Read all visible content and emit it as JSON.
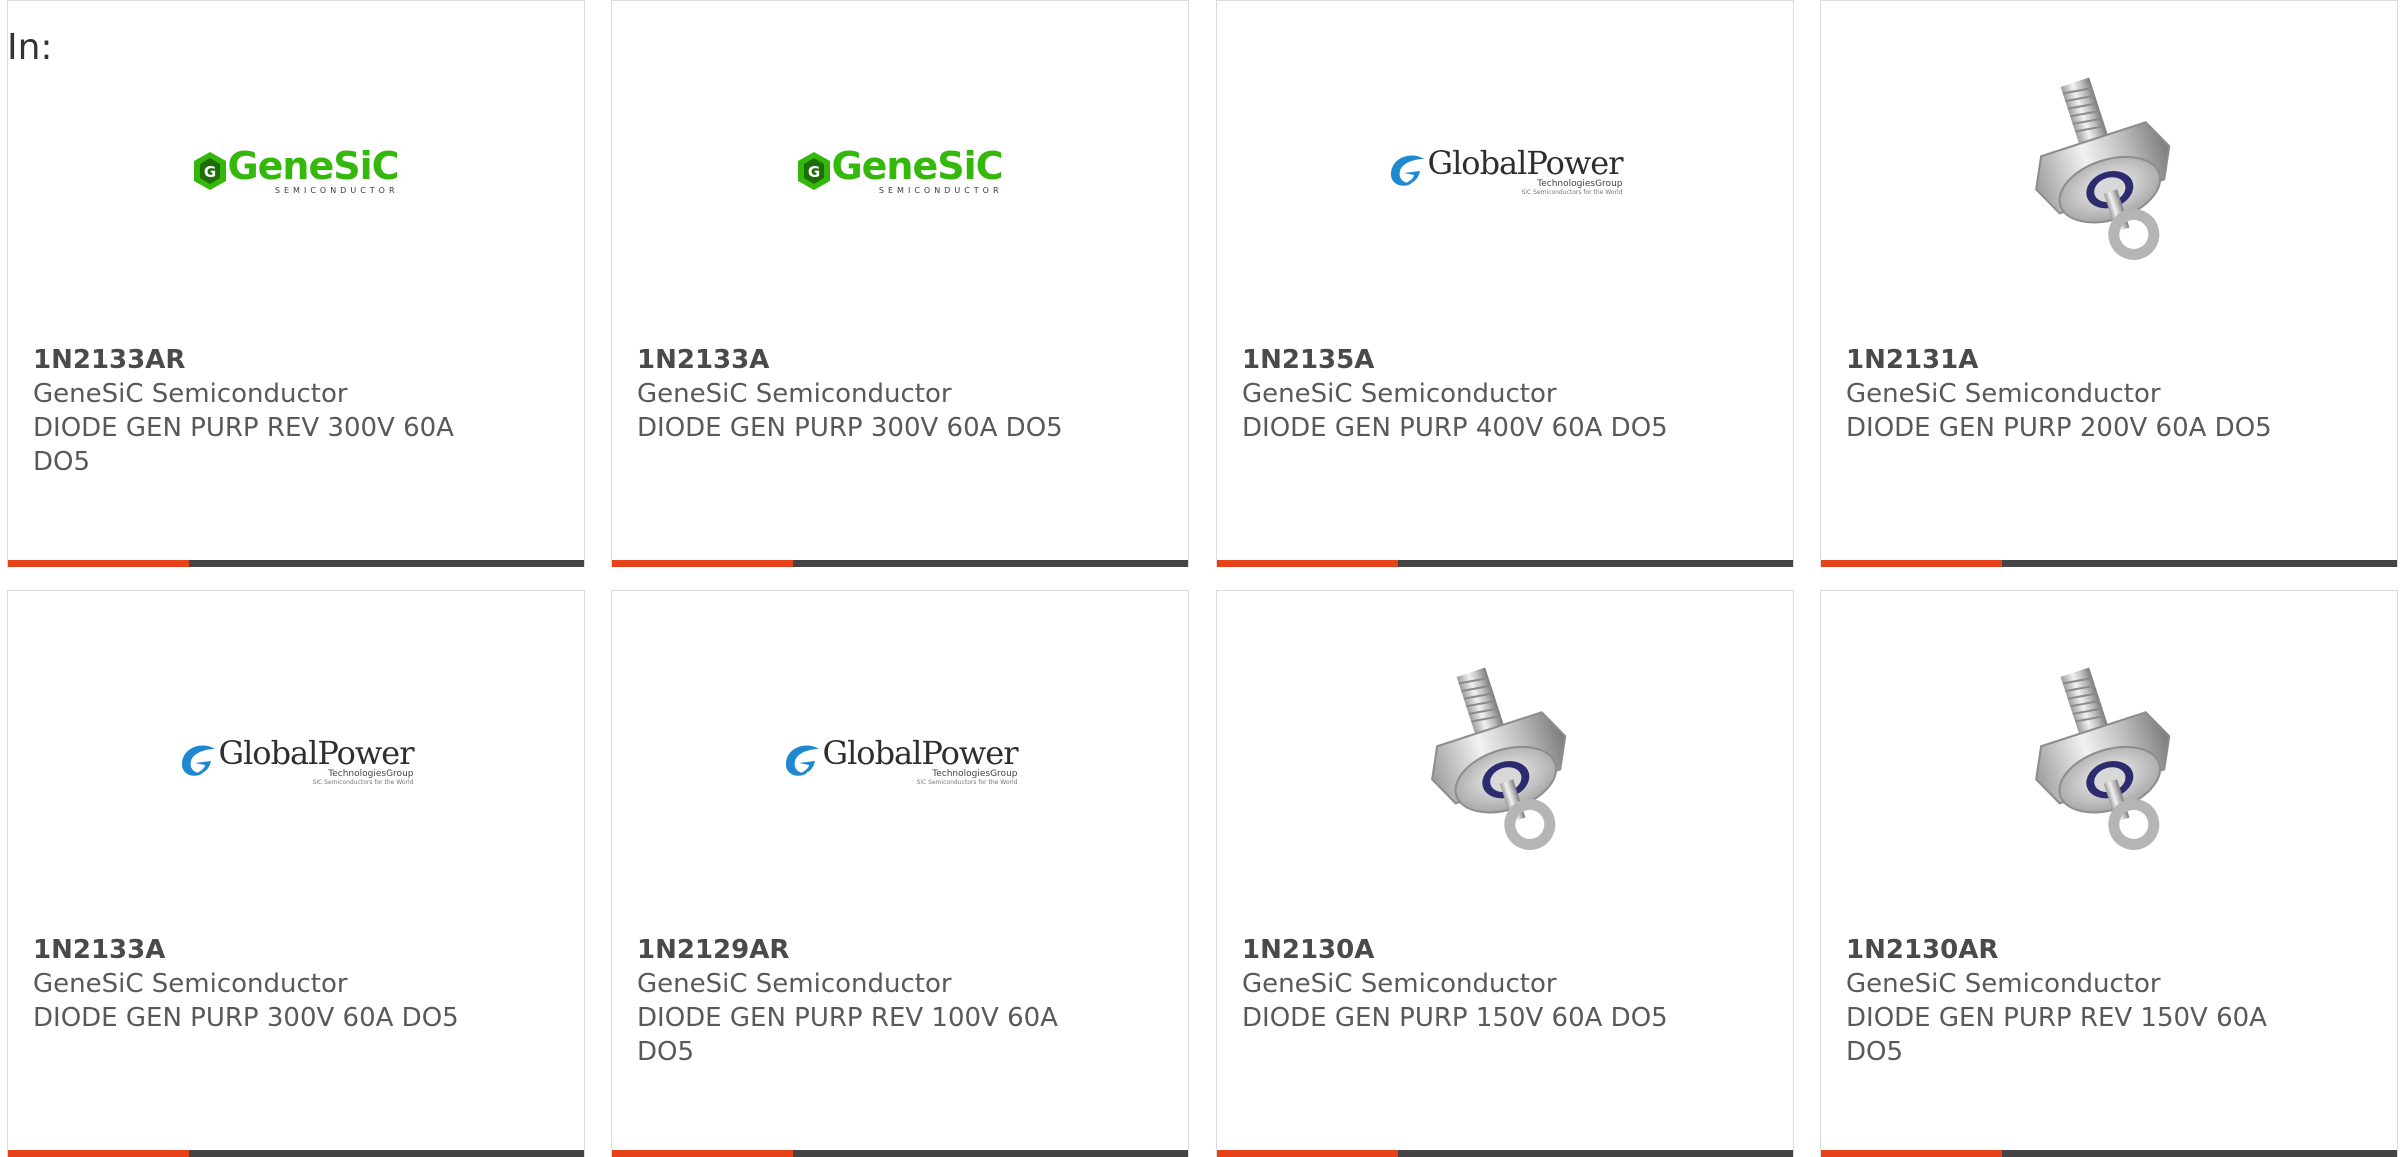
{
  "header": {
    "label": "In:"
  },
  "products": [
    {
      "part": "1N2133AR",
      "manufacturer": "GeneSiC Semiconductor",
      "description": "DIODE GEN PURP REV 300V 60A DO5",
      "image": "genesic-logo"
    },
    {
      "part": "1N2133A",
      "manufacturer": "GeneSiC Semiconductor",
      "description": "DIODE GEN PURP 300V 60A DO5",
      "image": "genesic-logo"
    },
    {
      "part": "1N2135A",
      "manufacturer": "GeneSiC Semiconductor",
      "description": "DIODE GEN PURP 400V 60A DO5",
      "image": "globalpower-logo"
    },
    {
      "part": "1N2131A",
      "manufacturer": "GeneSiC Semiconductor",
      "description": "DIODE GEN PURP 200V 60A DO5",
      "image": "diode-photo"
    },
    {
      "part": "1N2133A",
      "manufacturer": "GeneSiC Semiconductor",
      "description": "DIODE GEN PURP 300V 60A DO5",
      "image": "globalpower-logo"
    },
    {
      "part": "1N2129AR",
      "manufacturer": "GeneSiC Semiconductor",
      "description": "DIODE GEN PURP REV 100V 60A DO5",
      "image": "globalpower-logo"
    },
    {
      "part": "1N2130A",
      "manufacturer": "GeneSiC Semiconductor",
      "description": "DIODE GEN PURP 150V 60A DO5",
      "image": "diode-photo"
    },
    {
      "part": "1N2130AR",
      "manufacturer": "GeneSiC Semiconductor",
      "description": "DIODE GEN PURP REV 150V 60A DO5",
      "image": "diode-photo"
    }
  ],
  "logos": {
    "genesic": {
      "name": "GeneSiC",
      "sub": "SEMICONDUCTOR"
    },
    "globalpower": {
      "name": "GlobalPower",
      "sub": "TechnologiesGroup",
      "tagline": "SiC Semiconductors for the World"
    }
  },
  "colors": {
    "accent": "#e8421b",
    "bar": "#444444",
    "border": "#dcdcdc",
    "genesic_green": "#34b80c",
    "globalpower_blue": "#1e88d0"
  }
}
